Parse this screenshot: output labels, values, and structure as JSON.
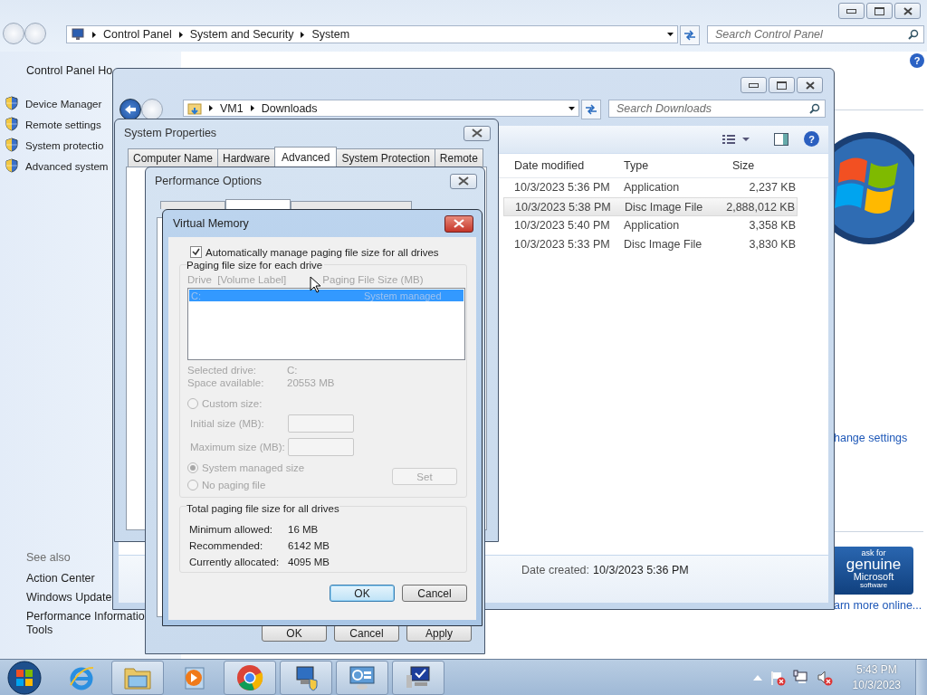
{
  "control_panel": {
    "path": [
      "Control Panel",
      "System and Security",
      "System"
    ],
    "search_placeholder": "Search Control Panel",
    "home_link": "Control Panel Ho",
    "tasks": [
      "Device Manager",
      "Remote settings",
      "System protectio",
      "Advanced system"
    ],
    "see_also_heading": "See also",
    "see_also": [
      "Action Center",
      "Windows Update",
      "Performance Informatio",
      "Tools"
    ],
    "help_label": "?",
    "change_settings_link": "hange settings",
    "learn_more_link": "arn more online...",
    "genuine_badge": [
      "ask for",
      "genuine",
      "Microsoft",
      "software"
    ]
  },
  "explorer": {
    "path": [
      "VM1",
      "Downloads"
    ],
    "search_placeholder": "Search Downloads",
    "help_label": "?",
    "columns": [
      "Date modified",
      "Type",
      "Size"
    ],
    "rows": [
      {
        "date": "10/3/2023 5:36 PM",
        "type": "Application",
        "size": "2,237 KB",
        "selected": false
      },
      {
        "date": "10/3/2023 5:38 PM",
        "type": "Disc Image File",
        "size": "2,888,012 KB",
        "selected": true
      },
      {
        "date": "10/3/2023 5:40 PM",
        "type": "Application",
        "size": "3,358 KB",
        "selected": false
      },
      {
        "date": "10/3/2023 5:33 PM",
        "type": "Disc Image File",
        "size": "3,830 KB",
        "selected": false
      }
    ],
    "details": {
      "label": "Date created:",
      "value": "10/3/2023 5:36 PM"
    }
  },
  "system_properties": {
    "title": "System Properties",
    "tabs": [
      {
        "label": "Computer Name",
        "selected": false
      },
      {
        "label": "Hardware",
        "selected": false
      },
      {
        "label": "Advanced",
        "selected": true
      },
      {
        "label": "System Protection",
        "selected": false
      },
      {
        "label": "Remote",
        "selected": false
      }
    ]
  },
  "performance_options": {
    "title": "Performance Options",
    "tabs": [
      {
        "selected": false
      },
      {
        "selected": true
      },
      {
        "selected": false
      }
    ],
    "buttons": [
      "OK",
      "Cancel",
      "Apply"
    ]
  },
  "virtual_memory": {
    "title": "Virtual Memory",
    "auto_manage": {
      "label": "Automatically manage paging file size for all drives",
      "checked": true
    },
    "group_title": "Paging file size for each drive",
    "list_headers": [
      "Drive  [Volume Label]",
      "Paging File Size (MB)"
    ],
    "drives": [
      {
        "drive": "C:",
        "size": "System managed",
        "selected": true
      }
    ],
    "sizing_disabled": true,
    "info": [
      {
        "label": "Selected drive:",
        "value": "C:"
      },
      {
        "label": "Space available:",
        "value": "20553 MB"
      }
    ],
    "custom": {
      "label": "Custom size:",
      "selected": false
    },
    "fields": [
      "Initial size (MB):",
      "Maximum size (MB):"
    ],
    "system_managed": {
      "label": "System managed size",
      "selected": true
    },
    "no_paging": {
      "label": "No paging file",
      "selected": false
    },
    "set_button": "Set",
    "totals_title": "Total paging file size for all drives",
    "totals": [
      {
        "label": "Minimum allowed:",
        "value": "16 MB"
      },
      {
        "label": "Recommended:",
        "value": "6142 MB"
      },
      {
        "label": "Currently allocated:",
        "value": "4095 MB"
      }
    ],
    "buttons": [
      "OK",
      "Cancel"
    ]
  },
  "taskbar": {
    "items": [
      {
        "kind": "ie",
        "running": false
      },
      {
        "kind": "folder",
        "running": true
      },
      {
        "kind": "media",
        "running": false
      },
      {
        "kind": "chrome",
        "running": true
      },
      {
        "kind": "network",
        "running": true
      },
      {
        "kind": "panel",
        "running": true
      },
      {
        "kind": "monitor",
        "running": true
      }
    ],
    "time": "5:43 PM",
    "date": "10/3/2023"
  }
}
